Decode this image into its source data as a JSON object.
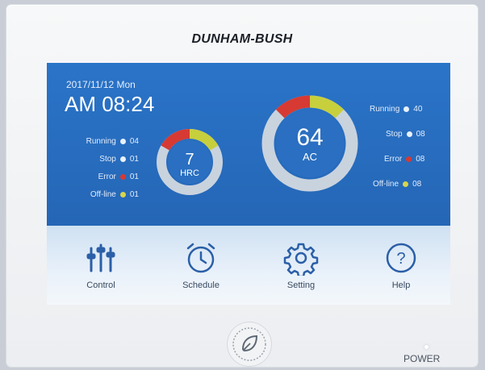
{
  "brand": "DUNHAM-BUSH",
  "status": {
    "date": "2017/11/12  Mon",
    "time": "AM 08:24"
  },
  "hrc": {
    "count": "7",
    "label": "HRC",
    "stats": [
      {
        "label": "Running",
        "value": "04",
        "color": "#e9f1fb"
      },
      {
        "label": "Stop",
        "value": "01",
        "color": "#e9f1fb"
      },
      {
        "label": "Error",
        "value": "01",
        "color": "#d63a33"
      },
      {
        "label": "Off-line",
        "value": "01",
        "color": "#d7d54a"
      }
    ]
  },
  "ac": {
    "count": "64",
    "label": "AC",
    "stats": [
      {
        "label": "Running",
        "value": "40",
        "color": "#e9f1fb"
      },
      {
        "label": "Stop",
        "value": "08",
        "color": "#e9f1fb"
      },
      {
        "label": "Error",
        "value": "08",
        "color": "#d63a33"
      },
      {
        "label": "Off-line",
        "value": "08",
        "color": "#d7d54a"
      }
    ]
  },
  "menu": {
    "control": "Control",
    "schedule": "Schedule",
    "setting": "Setting",
    "help": "Help"
  },
  "power_label": "POWER",
  "icons": {
    "control": "sliders-icon",
    "schedule": "clock-icon",
    "setting": "gear-icon",
    "help": "question-icon",
    "eco": "leaf-icon"
  },
  "colors": {
    "screen_blue": "#2a6fc1",
    "ring_gray": "#c9d3de",
    "error_red": "#d63a33",
    "offline_yellow": "#c7cf3d"
  }
}
